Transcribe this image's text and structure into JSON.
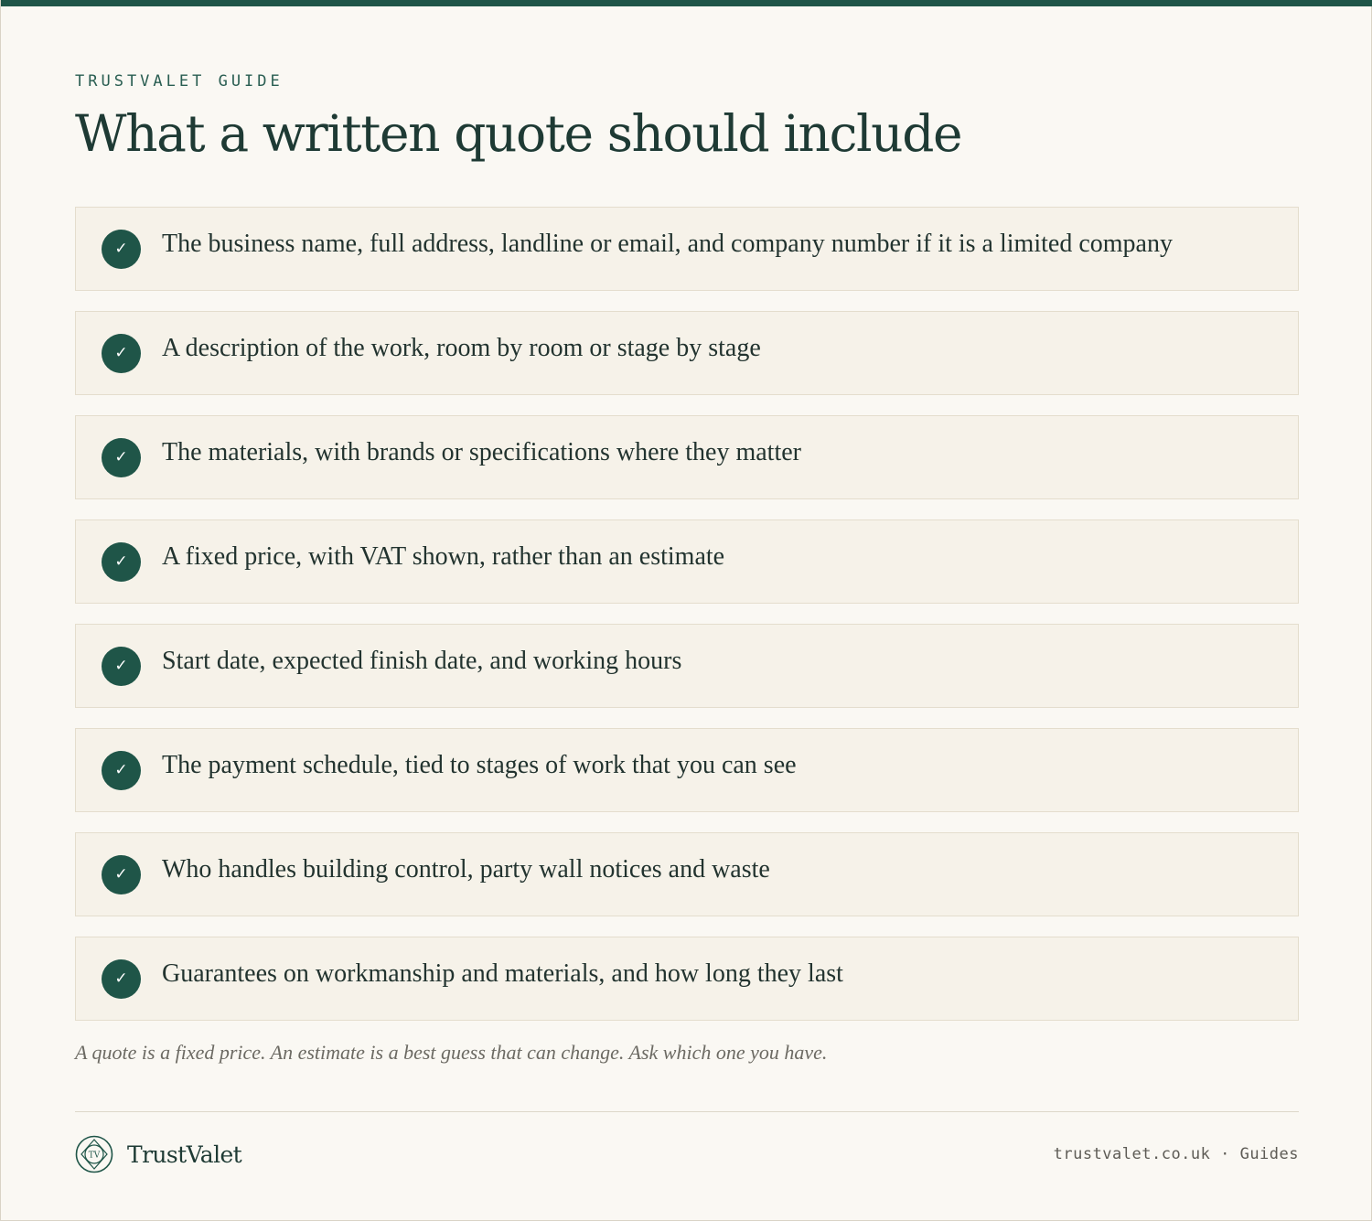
{
  "header": {
    "eyebrow": "TRUSTVALET GUIDE",
    "title": "What a written quote should include"
  },
  "checklist": {
    "items": [
      {
        "text": "The business name, full address, landline or email, and company number if it is a limited company"
      },
      {
        "text": "A description of the work, room by room or stage by stage"
      },
      {
        "text": "The materials, with brands or specifications where they matter"
      },
      {
        "text": "A fixed price, with VAT shown, rather than an estimate"
      },
      {
        "text": "Start date, expected finish date, and working hours"
      },
      {
        "text": "The payment schedule, tied to stages of work that you can see"
      },
      {
        "text": "Who handles building control, party wall notices and waste"
      },
      {
        "text": "Guarantees on workmanship and materials, and how long they last"
      }
    ],
    "check_icon": "check-icon",
    "check_glyph": "✓"
  },
  "note": "A quote is a fixed price. An estimate is a best guess that can change. Ask which one you have.",
  "footer": {
    "brand_name": "TrustValet",
    "logo_text": "TV",
    "logo_icon": "trustvalet-logo-icon",
    "meta": "trustvalet.co.uk · Guides"
  },
  "colors": {
    "accent": "#1f5548",
    "background": "#faf8f3",
    "card_background": "#f6f2e9",
    "text": "#22332f"
  }
}
